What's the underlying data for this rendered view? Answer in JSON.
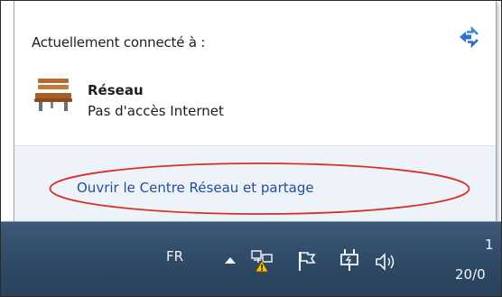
{
  "popup": {
    "heading": "Actuellement connecté à :",
    "network": {
      "name": "Réseau",
      "status": "Pas d'accès Internet",
      "icon": "network-bench-icon"
    },
    "refresh_icon": "refresh-arrows-icon",
    "open_center_link": "Ouvrir le Centre Réseau et partage",
    "highlight_color": "#d9302a"
  },
  "taskbar": {
    "language": "FR",
    "tray_icons": [
      "show-hidden-icons-icon",
      "network-warning-icon",
      "action-center-flag-icon",
      "power-icon",
      "volume-icon"
    ],
    "clock_time": "1",
    "clock_date": "20/0"
  },
  "colors": {
    "link": "#1f4f9c",
    "taskbar": "#34506d",
    "popup_footer": "#eef3fa"
  }
}
